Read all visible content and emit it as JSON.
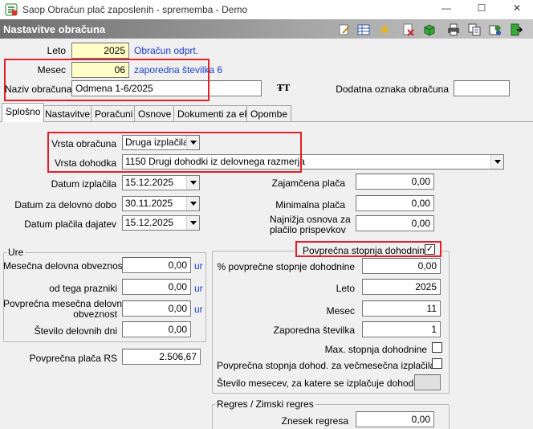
{
  "window": {
    "title": "Saop Obračun plač zaposlenih - sprememba - Demo"
  },
  "controls": {
    "minimize": "—",
    "maximize": "☐",
    "close": "✕"
  },
  "panel": {
    "title": "Nastavitve obračuna"
  },
  "toolbar": {
    "icons": [
      "edit-icon",
      "table-icon",
      "star-icon",
      "delete-icon",
      "cube-icon",
      "print-icon",
      "copy-icon",
      "export-icon",
      "exit-icon"
    ]
  },
  "header": {
    "leto_label": "Leto",
    "leto_value": "2025",
    "leto_status": "Obračun odprt.",
    "mesec_label": "Mesec",
    "mesec_value": "06",
    "mesec_note": "zaporedna številka 6",
    "naziv_label": "Naziv obračuna",
    "naziv_value": "Odmena 1-6/2025",
    "font_icon": "T̶T",
    "dodatna_label": "Dodatna oznaka obračuna",
    "dodatna_value": ""
  },
  "tabs": [
    "Splošno",
    "Nastavitve",
    "Poračuni",
    "Osnove",
    "Dokumenti za eR",
    "Opombe"
  ],
  "general": {
    "vrsta_obracuna_label": "Vrsta obračuna",
    "vrsta_obracuna_value": "Druga izplačila",
    "vrsta_dohodka_label": "Vrsta dohodka",
    "vrsta_dohodka_value": "1150  Drugi dohodki iz delovnega razmerja",
    "datum_izplacila_label": "Datum izplačila",
    "datum_izplacila_value": "15.12.2025",
    "datum_delovno_label": "Datum za delovno dobo",
    "datum_delovno_value": "30.11.2025",
    "datum_placila_label": "Datum plačila dajatev",
    "datum_placila_value": "15.12.2025",
    "zajamcena_label": "Zajamčena plača",
    "zajamcena_value": "0,00",
    "minimalna_label": "Minimalna plača",
    "minimalna_value": "0,00",
    "najnizja_label_1": "Najnižja osnova za",
    "najnizja_label_2": "plačilo prispevkov",
    "najnizja_value": "0,00"
  },
  "ure": {
    "title": "Ure",
    "mesecna_label": "Mesečna delovna obveznost",
    "mesecna_value": "0,00",
    "prazniki_label": "od tega prazniki",
    "prazniki_value": "0,00",
    "povprecna_label_1": "Povprečna mesečna delovna",
    "povprecna_label_2": "obveznost",
    "povprecna_value": "0,00",
    "stevilo_label": "Število delovnih dni",
    "stevilo_value": "0,00",
    "unit": "ur"
  },
  "placa_rs": {
    "label": "Povprečna plača RS",
    "value": "2.506,67"
  },
  "dohodnina": {
    "checkbox_label": "Povprečna stopnja dohodnine",
    "checked": "✓",
    "pct_label": "% povprečne stopnje dohodnine",
    "pct_value": "0,00",
    "leto_label": "Leto",
    "leto_value": "2025",
    "mesec_label": "Mesec",
    "mesec_value": "11",
    "zap_label": "Zaporedna številka",
    "zap_value": "1",
    "max_label": "Max. stopnja dohodnine",
    "vec_label": "Povprečna stopnja dohod. za večmesečna izplačila",
    "st_mesecev_label": "Število mesecev, za katere se izplačuje dohodek",
    "st_mesecev_value": ""
  },
  "regres": {
    "title": "Regres / Zimski regres",
    "znesek_label": "Znesek regresa",
    "znesek_value": "0,00"
  }
}
